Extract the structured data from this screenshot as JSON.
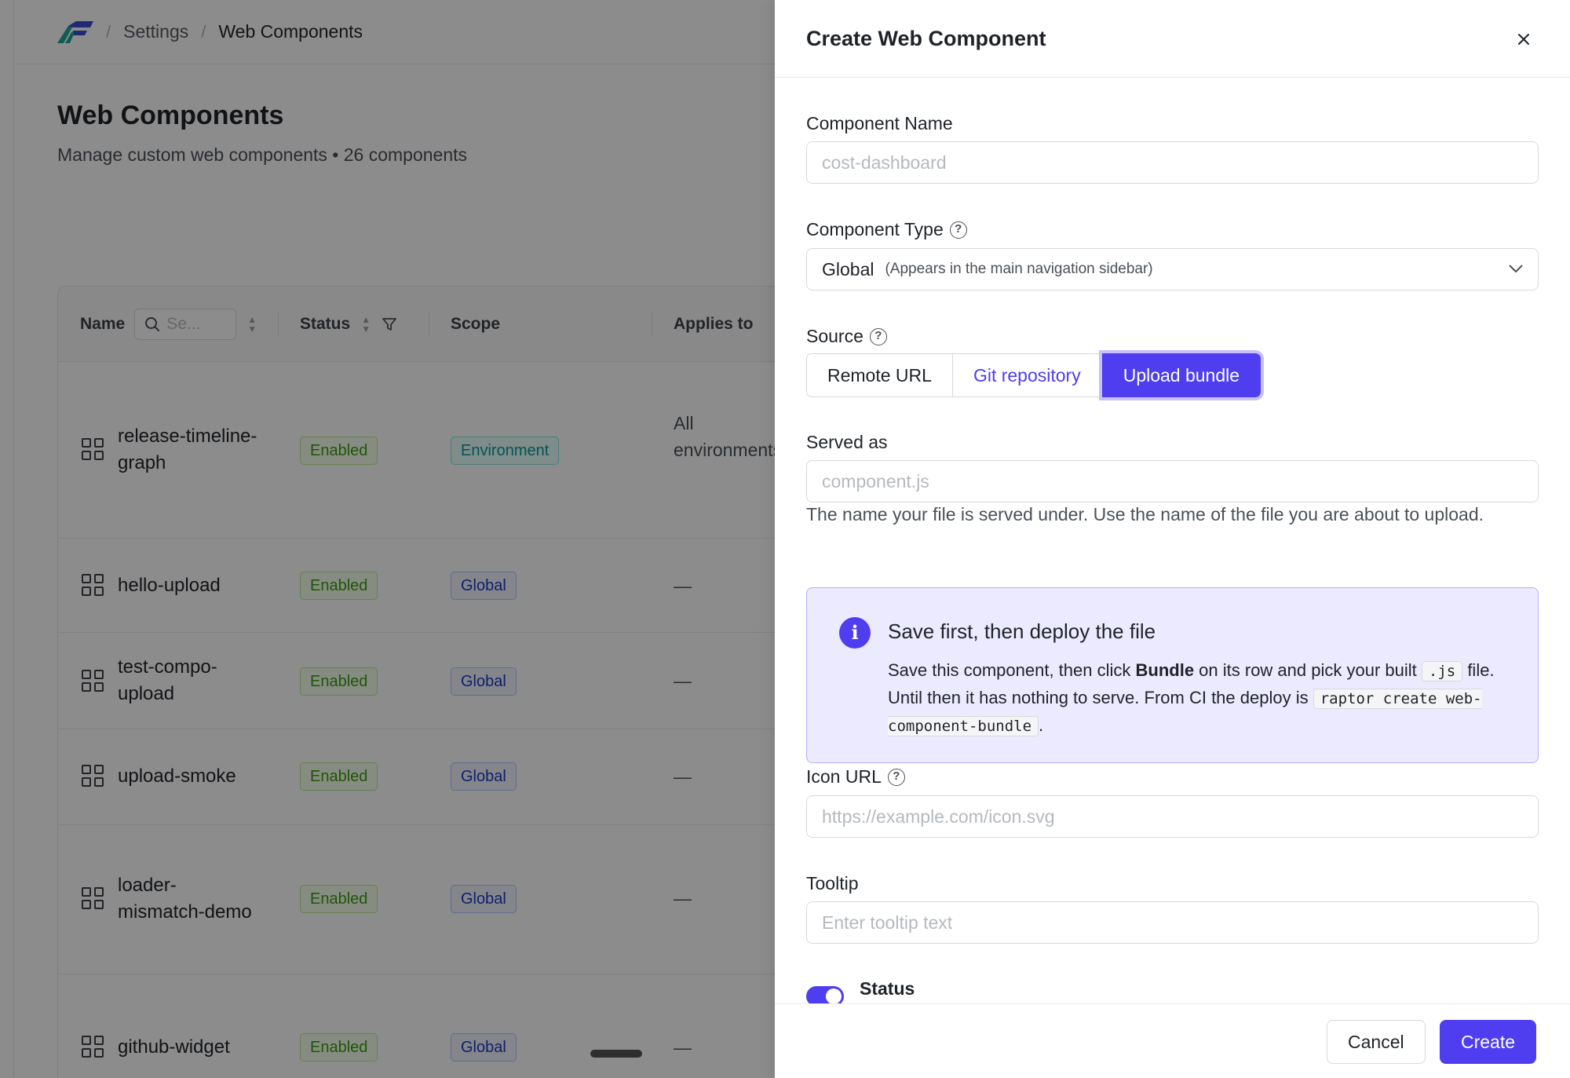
{
  "breadcrumb": {
    "items": [
      "Settings",
      "Web Components"
    ]
  },
  "page": {
    "title": "Web Components",
    "subtitle": "Manage custom web components • 26 components"
  },
  "table": {
    "columns": {
      "name": "Name",
      "search_placeholder": "Se...",
      "status": "Status",
      "scope": "Scope",
      "applies_to": "Applies to"
    },
    "rows": [
      {
        "name": "release-timeline-graph",
        "status": "Enabled",
        "scope": "Environment",
        "applies_to": "All environments"
      },
      {
        "name": "hello-upload",
        "status": "Enabled",
        "scope": "Global",
        "applies_to": "—"
      },
      {
        "name": "test-compo-upload",
        "status": "Enabled",
        "scope": "Global",
        "applies_to": "—"
      },
      {
        "name": "upload-smoke",
        "status": "Enabled",
        "scope": "Global",
        "applies_to": "—"
      },
      {
        "name": "loader-mismatch-demo",
        "status": "Enabled",
        "scope": "Global",
        "applies_to": "—"
      },
      {
        "name": "github-widget",
        "status": "Enabled",
        "scope": "Global",
        "applies_to": "—"
      }
    ]
  },
  "drawer": {
    "title": "Create Web Component",
    "component_name": {
      "label": "Component Name",
      "placeholder": "cost-dashboard",
      "value": ""
    },
    "component_type": {
      "label": "Component Type",
      "selected": "Global",
      "hint": "(Appears in the main navigation sidebar)"
    },
    "source": {
      "label": "Source",
      "options": [
        "Remote URL",
        "Git repository",
        "Upload bundle"
      ],
      "selected": "Upload bundle"
    },
    "served_as": {
      "label": "Served as",
      "placeholder": "component.js",
      "value": "",
      "help": "The name your file is served under. Use the name of the file you are about to upload."
    },
    "info": {
      "title": "Save first, then deploy the file",
      "text_1": "Save this component, then click ",
      "bold": "Bundle",
      "text_2": " on its row and pick your built ",
      "code_1": ".js",
      "text_3": " file. Until then it has nothing to serve. From CI the deploy is ",
      "code_2": "raptor create web-component-bundle",
      "text_4": "."
    },
    "icon_url": {
      "label": "Icon URL",
      "placeholder": "https://example.com/icon.svg",
      "value": ""
    },
    "tooltip": {
      "label": "Tooltip",
      "placeholder": "Enter tooltip text",
      "value": ""
    },
    "status": {
      "label": "Status",
      "enabled": true
    },
    "footer": {
      "cancel": "Cancel",
      "create": "Create"
    }
  },
  "colors": {
    "accent": "#4f3df0",
    "info_bg": "#eceaff",
    "overlay": "rgba(0,0,0,0.45)"
  }
}
